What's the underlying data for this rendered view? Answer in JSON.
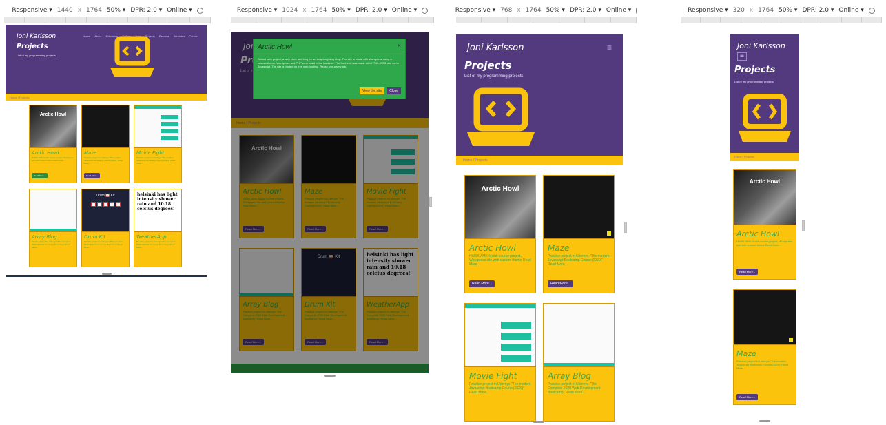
{
  "colors": {
    "hero": "#53397e",
    "accent": "#fcc30c",
    "title_green": "#3ea84a",
    "modal_green": "#2ea84a"
  },
  "devbars": [
    {
      "device": "Responsive ▾",
      "width": "1440",
      "sep": "x",
      "height": "1764",
      "zoom": "50% ▾",
      "dpr": "DPR: 2.0 ▾",
      "net": "Online ▾",
      "icon": "rotate-icon"
    },
    {
      "device": "Responsive ▾",
      "width": "1024",
      "sep": "x",
      "height": "1764",
      "zoom": "50% ▾",
      "dpr": "DPR: 2.0 ▾",
      "net": "Online ▾",
      "icon": "rotate-icon"
    },
    {
      "device": "Responsive ▾",
      "width": "768",
      "sep": "x",
      "height": "1764",
      "zoom": "50% ▾",
      "dpr": "DPR: 2.0 ▾",
      "net": "Online ▾",
      "icon": "rotate-icon"
    },
    {
      "device": "Responsive ▾",
      "width": "320",
      "sep": "x",
      "height": "1764",
      "zoom": "50% ▾",
      "dpr": "DPR: 2.0 ▾",
      "net": "Online ▾",
      "icon": "rotate-icon"
    }
  ],
  "site": {
    "brand": "Joni Karlsson",
    "page_title": "Projects",
    "subtitle": "List of my programming projects",
    "nav": [
      "Home",
      "About",
      "Education",
      "Gallery",
      "Jobs",
      "Projects",
      "Resume",
      "Websites",
      "Contact"
    ],
    "breadcrumb": "Home / Projects",
    "read_more": "Read More..."
  },
  "cards": [
    {
      "title": "Arctic Howl",
      "desc": "HAWK AMK-toolkit course project, Wordpress site with custom theme Read More...",
      "thumb_text": "Arctic Howl"
    },
    {
      "title": "Maze",
      "desc": "Practice project in Udemys \"The modern Javascript Bootcamp Course(2020)\" Read More...",
      "thumb_text": ""
    },
    {
      "title": "Movie Fight",
      "desc": "Practice project in Udemys \"The modern Javascript Bootcamp Course(2020)\" Read More...",
      "thumb_text": ""
    },
    {
      "title": "Array Blog",
      "desc": "Practice project in Udemys \"The Complete 2020 Web Development Bootcamp\" Read More...",
      "thumb_text": ""
    },
    {
      "title": "Drum Kit",
      "desc": "Practice project in Udemys \"The Complete 2020 Web Development Bootcamp\" Read More...",
      "thumb_text": "Drum 🥁 Kit"
    },
    {
      "title": "WeatherApp",
      "desc": "Practice project in Udemys \"The Complete 2020 Web Development Bootcamp\" Read More...",
      "thumb_text": "helsinki has light intensity shower rain and 10.18 celcius degrees!"
    }
  ],
  "modal": {
    "title": "Arctic Howl",
    "close": "×",
    "body": "School web project, a web store and blog for an imaginary dog shop. The site is made with Wordpress using a custom theme. Wordpress and PHP were used in the backend. The front end was made with HTML, CSS and some Javascript. The site is hosted on free web hosting. Please use a new tab.",
    "view_label": "View the site",
    "close_label": "Close"
  }
}
